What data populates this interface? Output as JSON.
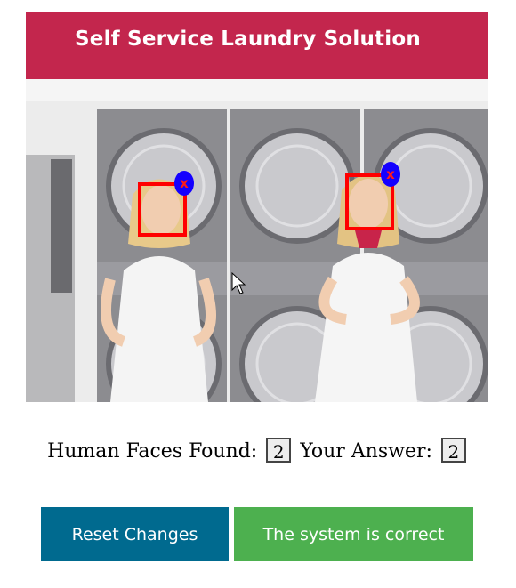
{
  "photo": {
    "sign_text": "Self Service Laundry Solution"
  },
  "faces": [
    {
      "id": "face-1",
      "remove_glyph": "x"
    },
    {
      "id": "face-2",
      "remove_glyph": "x"
    }
  ],
  "result": {
    "found_label": "Human Faces Found:",
    "found_value": "2",
    "answer_label": "Your Answer:",
    "answer_value": "2"
  },
  "buttons": {
    "reset_label": "Reset Changes",
    "correct_label": "The system is correct"
  },
  "colors": {
    "face_box": "#ff0000",
    "remove_button": "#1400ff",
    "reset_button": "#006a8f",
    "correct_button": "#4db04f"
  }
}
